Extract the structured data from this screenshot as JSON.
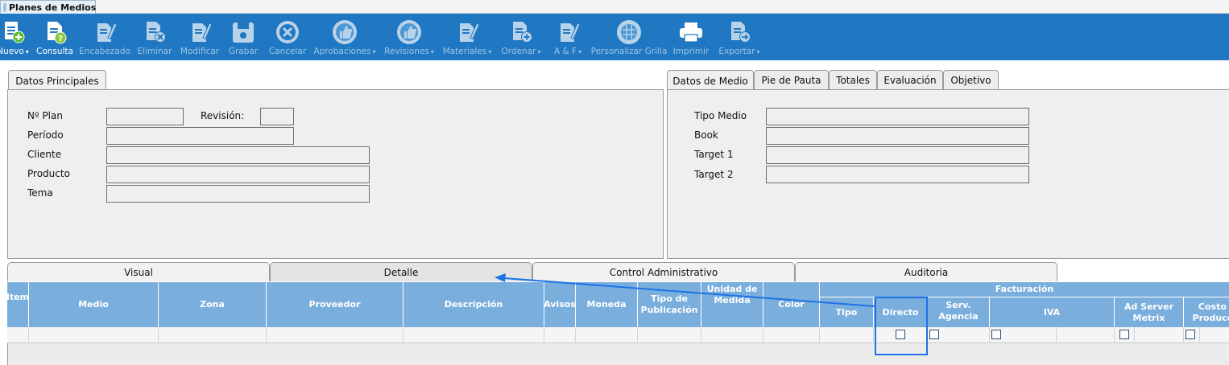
{
  "window": {
    "title": "Planes de Medios"
  },
  "toolbar": {
    "buttons": [
      {
        "label": "Nuevo",
        "caret": "▾",
        "enabled": true,
        "icon": "new-doc-plus-icon"
      },
      {
        "label": "Consulta",
        "enabled": true,
        "icon": "doc-help-icon"
      },
      {
        "label": "Encabezado",
        "enabled": false,
        "icon": "doc-edit-icon"
      },
      {
        "label": "Eliminar",
        "enabled": false,
        "icon": "doc-delete-icon"
      },
      {
        "label": "Modificar",
        "enabled": false,
        "icon": "doc-pencil-icon"
      },
      {
        "label": "Grabar",
        "enabled": false,
        "icon": "save-disk-icon"
      },
      {
        "label": "Cancelar",
        "enabled": false,
        "icon": "cancel-circle-icon"
      },
      {
        "label": "Aprobaciones",
        "caret": "▾",
        "enabled": false,
        "icon": "thumbs-up-icon"
      },
      {
        "label": "Revisiones",
        "caret": "▾",
        "enabled": false,
        "icon": "thumbs-up-icon"
      },
      {
        "label": "Materiales",
        "caret": "▾",
        "enabled": false,
        "icon": "doc-pencil-icon"
      },
      {
        "label": "Ordenar",
        "caret": "▾",
        "enabled": false,
        "icon": "doc-add-icon"
      },
      {
        "label": "A & F",
        "caret": "▾",
        "enabled": false,
        "icon": "doc-pencil-icon"
      },
      {
        "label": "Personalizar Grilla",
        "enabled": false,
        "icon": "grid-globe-icon"
      },
      {
        "label": "Imprimir",
        "enabled": false,
        "icon": "printer-icon"
      },
      {
        "label": "Exportar",
        "caret": "▾",
        "enabled": false,
        "icon": "doc-export-icon"
      }
    ]
  },
  "left_panel": {
    "tab": "Datos Principales",
    "fields": {
      "nro_plan": {
        "label": "Nº Plan",
        "value": ""
      },
      "revision": {
        "label": "Revisión:",
        "value": ""
      },
      "periodo": {
        "label": "Período",
        "value": ""
      },
      "cliente": {
        "label": "Cliente",
        "value": ""
      },
      "producto": {
        "label": "Producto",
        "value": ""
      },
      "tema": {
        "label": "Tema",
        "value": ""
      }
    }
  },
  "right_panel": {
    "tabs": [
      "Datos de Medio",
      "Pie de Pauta",
      "Totales",
      "Evaluación",
      "Objetivo"
    ],
    "active_tab": "Datos de Medio",
    "fields": {
      "tipo_medio": {
        "label": "Tipo Medio",
        "value": ""
      },
      "book": {
        "label": "Book",
        "value": ""
      },
      "target1": {
        "label": "Target 1",
        "value": ""
      },
      "target2": {
        "label": "Target 2",
        "value": ""
      }
    }
  },
  "bottom_tabs": {
    "items": [
      "Visual",
      "Detalle",
      "Control Administrativo",
      "Auditoria"
    ],
    "active": "Detalle"
  },
  "grid": {
    "columns": {
      "item": "Item",
      "medio": "Medio",
      "zona": "Zona",
      "proveedor": "Proveedor",
      "descripcion": "Descripción",
      "avisos": "Avisos",
      "moneda": "Moneda",
      "tipo_publicacion": "Tipo de Publicación",
      "unidad_medida": "Unidad de Medida",
      "color": "Color",
      "facturacion": "Facturación",
      "tipo": "Tipo",
      "directo": "Directo",
      "serv_agencia": "Serv. Agencia",
      "iva": "IVA",
      "ad_server": "Ad Server Metrix",
      "costo_produccion": "Costo de Producción"
    },
    "rows": [
      {
        "directo": false,
        "serv_agencia": false,
        "iva": false,
        "ad_server": false,
        "costo_produccion": false
      }
    ]
  },
  "colors": {
    "toolbar_bg": "#1f78c1",
    "grid_header_bg": "#7aaedc",
    "highlight": "#1e73e8"
  }
}
